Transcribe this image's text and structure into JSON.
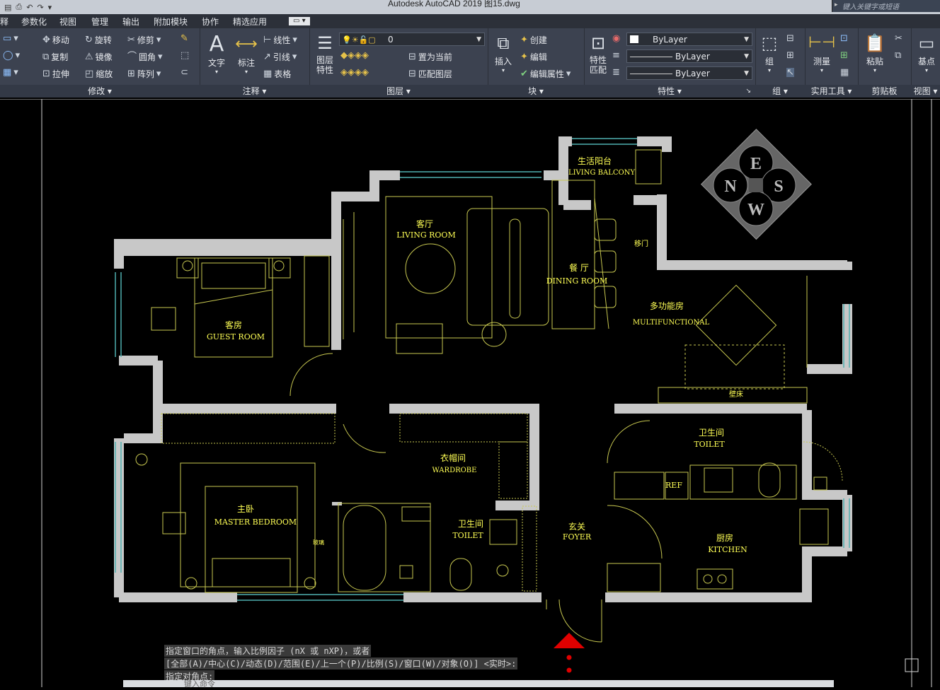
{
  "window": {
    "title": "Autodesk AutoCAD 2019    图15.dwg",
    "search_placeholder": "键入关键字或短语"
  },
  "menu": [
    "释",
    "参数化",
    "视图",
    "管理",
    "输出",
    "附加模块",
    "协作",
    "精选应用"
  ],
  "modify": {
    "move": "移动",
    "rotate": "旋转",
    "trim": "修剪",
    "copy": "复制",
    "mirror": "镜像",
    "fillet": "圆角",
    "stretch": "拉伸",
    "scale": "缩放",
    "array": "阵列",
    "footer": "修改"
  },
  "annotation": {
    "text": "文字",
    "dimension": "标注",
    "linear": "线性",
    "leader": "引线",
    "table": "表格",
    "footer": "注释"
  },
  "layers": {
    "props": "图层\n特性",
    "current_layer": "0",
    "set_current": "置为当前",
    "match_layer": "匹配图层",
    "footer": "图层"
  },
  "block": {
    "insert": "插入",
    "create": "创建",
    "edit": "编辑",
    "edit_attr": "编辑属性",
    "footer": "块"
  },
  "properties": {
    "match": "特性\n匹配",
    "color": "ByLayer",
    "linetype": "ByLayer",
    "lineweight": "ByLayer",
    "footer": "特性"
  },
  "group": {
    "label": "组",
    "footer": "组"
  },
  "utilities": {
    "measure": "测量",
    "footer": "实用工具"
  },
  "clipboard": {
    "paste": "粘贴",
    "footer": "剪贴板"
  },
  "view": {
    "base": "基点",
    "footer": "视图"
  },
  "rooms": {
    "balcony_cn": "生活阳台",
    "balcony_en": "LIVING BALCONY",
    "living_cn": "客厅",
    "living_en": "LIVING ROOM",
    "dining_cn": "餐 厅",
    "dining_en": "DINING ROOM",
    "sliding_door": "移门",
    "multi_cn": "多功能房",
    "multi_en": "MULTIFUNCTIONAL",
    "guest_cn": "客房",
    "guest_en": "GUEST ROOM",
    "wallbed": "壁床",
    "toilet1_cn": "卫生间",
    "toilet1_en": "TOILET",
    "wardrobe_cn": "衣帽间",
    "wardrobe_en": "WARDROBE",
    "master_cn": "主卧",
    "master_en": "MASTER BEDROOM",
    "toilet2_cn": "卫生间",
    "toilet2_en": "TOILET",
    "foyer_cn": "玄关",
    "foyer_en": "FOYER",
    "ref": "REF",
    "kitchen_cn": "厨房",
    "kitchen_en": "KITCHEN",
    "small_note": "玻璃"
  },
  "compass": {
    "e": "E",
    "n": "N",
    "s": "S",
    "w": "W"
  },
  "command": {
    "line1": "指定窗口的角点，输入比例因子 (nX 或 nXP)，或者",
    "line2": "[全部(A)/中心(C)/动态(D)/范围(E)/上一个(P)/比例(S)/窗口(W)/对象(O)] <实时>:",
    "line3": "指定对角点:",
    "input_placeholder": "键入命令"
  },
  "colors": {
    "wall": "#c8c8c8",
    "line": "#c8c850",
    "label": "#ffff55",
    "ribbon": "#3c4250",
    "canvas": "#000000"
  }
}
